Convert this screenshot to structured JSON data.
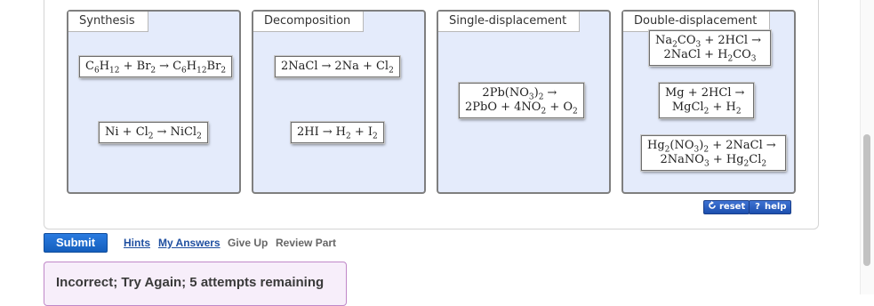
{
  "bins": [
    {
      "label": "Synthesis",
      "cards": [
        {
          "lines": [
            [
              {
                "t": "C"
              },
              {
                "t": "6",
                "s": "sub"
              },
              {
                "t": "H"
              },
              {
                "t": "12",
                "s": "sub"
              },
              {
                "t": " + Br"
              },
              {
                "t": "2",
                "s": "sub"
              },
              {
                "t": "→",
                "s": "arrow"
              },
              {
                "t": "C"
              },
              {
                "t": "6",
                "s": "sub"
              },
              {
                "t": "H"
              },
              {
                "t": "12",
                "s": "sub"
              },
              {
                "t": "Br"
              },
              {
                "t": "2",
                "s": "sub"
              }
            ]
          ]
        },
        {
          "lines": [
            [
              {
                "t": "Ni + Cl"
              },
              {
                "t": "2",
                "s": "sub"
              },
              {
                "t": "→",
                "s": "arrow"
              },
              {
                "t": "NiCl"
              },
              {
                "t": "2",
                "s": "sub"
              }
            ]
          ]
        }
      ]
    },
    {
      "label": "Decomposition",
      "cards": [
        {
          "lines": [
            [
              {
                "t": "2NaCl"
              },
              {
                "t": "→",
                "s": "arrow"
              },
              {
                "t": "2Na + Cl"
              },
              {
                "t": "2",
                "s": "sub"
              }
            ]
          ]
        },
        {
          "lines": [
            [
              {
                "t": "2HI"
              },
              {
                "t": "→",
                "s": "arrow"
              },
              {
                "t": "H"
              },
              {
                "t": "2",
                "s": "sub"
              },
              {
                "t": " + I"
              },
              {
                "t": "2",
                "s": "sub"
              }
            ]
          ]
        }
      ]
    },
    {
      "label": "Single-displacement",
      "cards": [
        {
          "lines": [
            [
              {
                "t": "2Pb(NO"
              },
              {
                "t": "3",
                "s": "sub"
              },
              {
                "t": ")"
              },
              {
                "t": "2",
                "s": "sub"
              },
              {
                "t": "→",
                "s": "arrow"
              }
            ],
            [
              {
                "t": "2PbO + 4NO"
              },
              {
                "t": "2",
                "s": "sub"
              },
              {
                "t": " + O"
              },
              {
                "t": "2",
                "s": "sub"
              }
            ]
          ]
        }
      ]
    },
    {
      "label": "Double-displacement",
      "cards": [
        {
          "lines": [
            [
              {
                "t": "Na"
              },
              {
                "t": "2",
                "s": "sub"
              },
              {
                "t": "CO"
              },
              {
                "t": "3",
                "s": "sub"
              },
              {
                "t": " + 2HCl"
              },
              {
                "t": "→",
                "s": "arrow"
              }
            ],
            [
              {
                "t": "2NaCl + H"
              },
              {
                "t": "2",
                "s": "sub"
              },
              {
                "t": "CO"
              },
              {
                "t": "3",
                "s": "sub"
              }
            ]
          ]
        },
        {
          "lines": [
            [
              {
                "t": "Mg + 2HCl"
              },
              {
                "t": "→",
                "s": "arrow"
              }
            ],
            [
              {
                "t": "MgCl"
              },
              {
                "t": "2",
                "s": "sub"
              },
              {
                "t": " + H"
              },
              {
                "t": "2",
                "s": "sub"
              }
            ]
          ]
        },
        {
          "lines": [
            [
              {
                "t": "Hg"
              },
              {
                "t": "2",
                "s": "sub"
              },
              {
                "t": "(NO"
              },
              {
                "t": "3",
                "s": "sub"
              },
              {
                "t": ")"
              },
              {
                "t": "2",
                "s": "sub"
              },
              {
                "t": " + 2NaCl"
              },
              {
                "t": "→",
                "s": "arrow"
              }
            ],
            [
              {
                "t": "2NaNO"
              },
              {
                "t": "3",
                "s": "sub"
              },
              {
                "t": " + Hg"
              },
              {
                "t": "2",
                "s": "sub"
              },
              {
                "t": "Cl"
              },
              {
                "t": "2",
                "s": "sub"
              }
            ]
          ]
        }
      ]
    }
  ],
  "controls": {
    "reset": "reset",
    "help": "help"
  },
  "actions": {
    "submit": "Submit",
    "hints": "Hints",
    "my_answers": "My Answers",
    "give_up": "Give Up",
    "review_part": "Review Part"
  },
  "feedback": "Incorrect; Try Again; 5 attempts remaining",
  "icons": {
    "reset": "reset-icon",
    "help": "help-icon"
  },
  "colors": {
    "bin_fill": "#e4ebfb",
    "submit_blue": "#1f6fd6",
    "feedback_border": "#c088c8",
    "link_blue": "#1f4fa0"
  }
}
